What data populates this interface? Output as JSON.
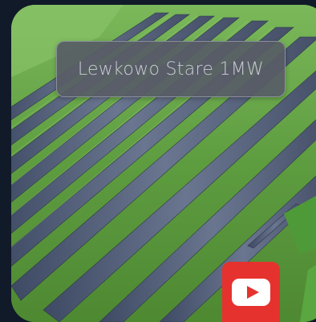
{
  "video": {
    "title": "Lewkowo Stare 1MW"
  },
  "colors": {
    "page_background": "#111a28",
    "grass": "#5b9a3e",
    "panel": "#4a5670",
    "title_box": "#585c66",
    "youtube_red": "#e5322e"
  },
  "icons": {
    "play": "youtube-play-icon"
  }
}
